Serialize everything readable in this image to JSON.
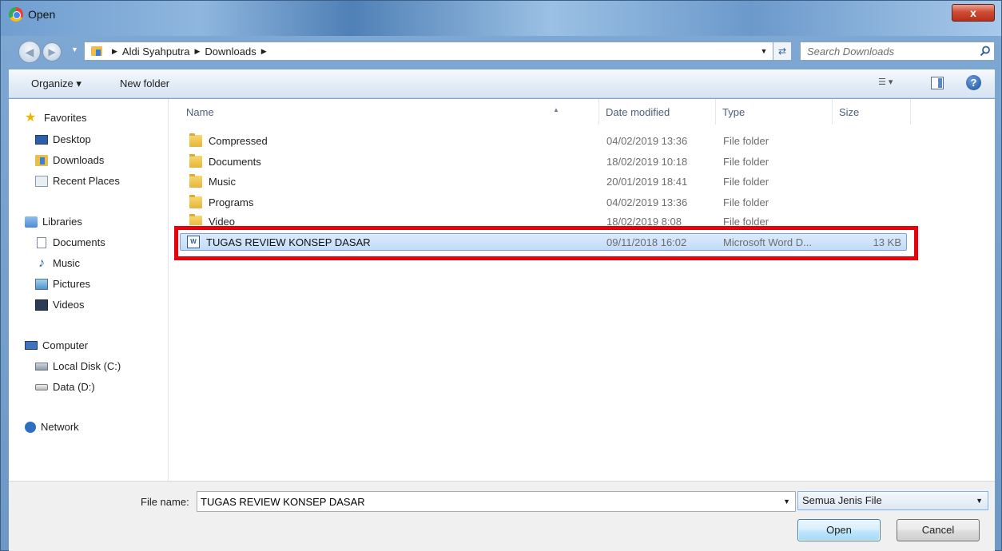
{
  "window": {
    "title": "Open",
    "close_label": "x"
  },
  "address": {
    "path": [
      "Aldi Syahputra",
      "Downloads"
    ],
    "separator": "▶"
  },
  "search": {
    "placeholder": "Search Downloads"
  },
  "toolbar": {
    "organize_label": "Organize ▾",
    "new_folder_label": "New folder",
    "help_label": "?"
  },
  "nav": {
    "favorites": "Favorites",
    "favorites_items": [
      "Desktop",
      "Downloads",
      "Recent Places"
    ],
    "libraries": "Libraries",
    "libraries_items": [
      "Documents",
      "Music",
      "Pictures",
      "Videos"
    ],
    "computer": "Computer",
    "computer_items": [
      "Local Disk (C:)",
      "Data (D:)"
    ],
    "network": "Network"
  },
  "columns": {
    "name": "Name",
    "date": "Date modified",
    "type": "Type",
    "size": "Size"
  },
  "files": [
    {
      "name": "Compressed",
      "date": "04/02/2019 13:36",
      "type": "File folder",
      "size": "",
      "kind": "folder"
    },
    {
      "name": "Documents",
      "date": "18/02/2019 10:18",
      "type": "File folder",
      "size": "",
      "kind": "folder"
    },
    {
      "name": "Music",
      "date": "20/01/2019 18:41",
      "type": "File folder",
      "size": "",
      "kind": "folder"
    },
    {
      "name": "Programs",
      "date": "04/02/2019 13:36",
      "type": "File folder",
      "size": "",
      "kind": "folder"
    },
    {
      "name": "Video",
      "date": "18/02/2019 8:08",
      "type": "File folder",
      "size": "",
      "kind": "folder"
    },
    {
      "name": "TUGAS REVIEW KONSEP DASAR",
      "date": "09/11/2018 16:02",
      "type": "Microsoft Word D...",
      "size": "13 KB",
      "kind": "word",
      "selected": true
    }
  ],
  "bottom": {
    "file_name_label": "File name:",
    "file_name_value": "TUGAS REVIEW KONSEP DASAR",
    "filter_value": "Semua Jenis File",
    "open_label": "Open",
    "cancel_label": "Cancel"
  },
  "colors": {
    "selection": "#c1dcf8",
    "highlight_box": "#e8000b"
  }
}
